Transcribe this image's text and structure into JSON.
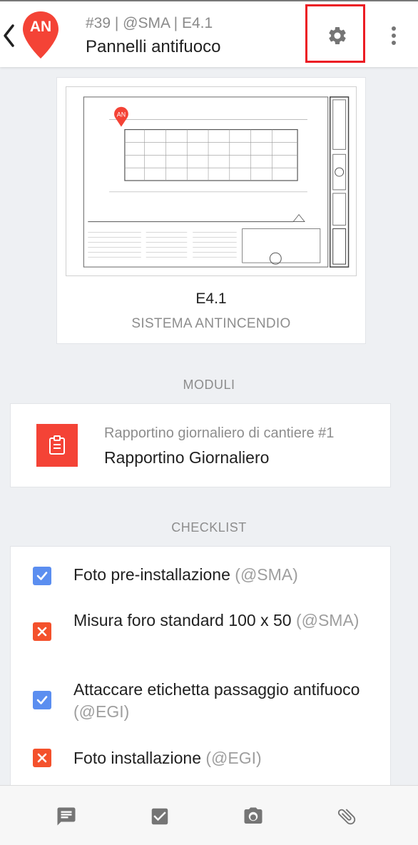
{
  "header": {
    "avatar_initials": "AN",
    "avatar_color": "#f44336",
    "subtitle": "#39 | @SMA | E4.1",
    "title": "Pannelli antifuoco",
    "back_icon": "chevron-left-icon",
    "settings_icon": "gear-icon",
    "more_icon": "more-vert-icon",
    "highlight_color": "#ec1c24"
  },
  "drawing": {
    "sheet_code": "E4.1",
    "sheet_name": "SISTEMA ANTINCENDIO",
    "pin_label": "AN"
  },
  "modules": {
    "section_label": "MODULI",
    "items": [
      {
        "subtitle": "Rapportino giornaliero di cantiere #1",
        "title": "Rapportino Giornaliero",
        "icon": "clipboard-icon",
        "icon_color": "#f44336"
      }
    ]
  },
  "checklist": {
    "section_label": "CHECKLIST",
    "items": [
      {
        "text": "Foto pre-installazione",
        "assignee": "(@SMA)",
        "status": "checked"
      },
      {
        "text": "Misura foro standard 100 x 50",
        "assignee": "(@SMA)",
        "status": "failed"
      },
      {
        "text": "Attaccare etichetta passaggio antifuoco",
        "assignee": "(@EGI)",
        "status": "checked"
      },
      {
        "text": "Foto installazione",
        "assignee": "(@EGI)",
        "status": "failed"
      }
    ],
    "checked_color": "#5b8ef0",
    "failed_color": "#f4512c"
  },
  "bottom_bar": {
    "icons": [
      "comment-icon",
      "checkbox-icon",
      "camera-icon",
      "attachment-icon"
    ]
  }
}
